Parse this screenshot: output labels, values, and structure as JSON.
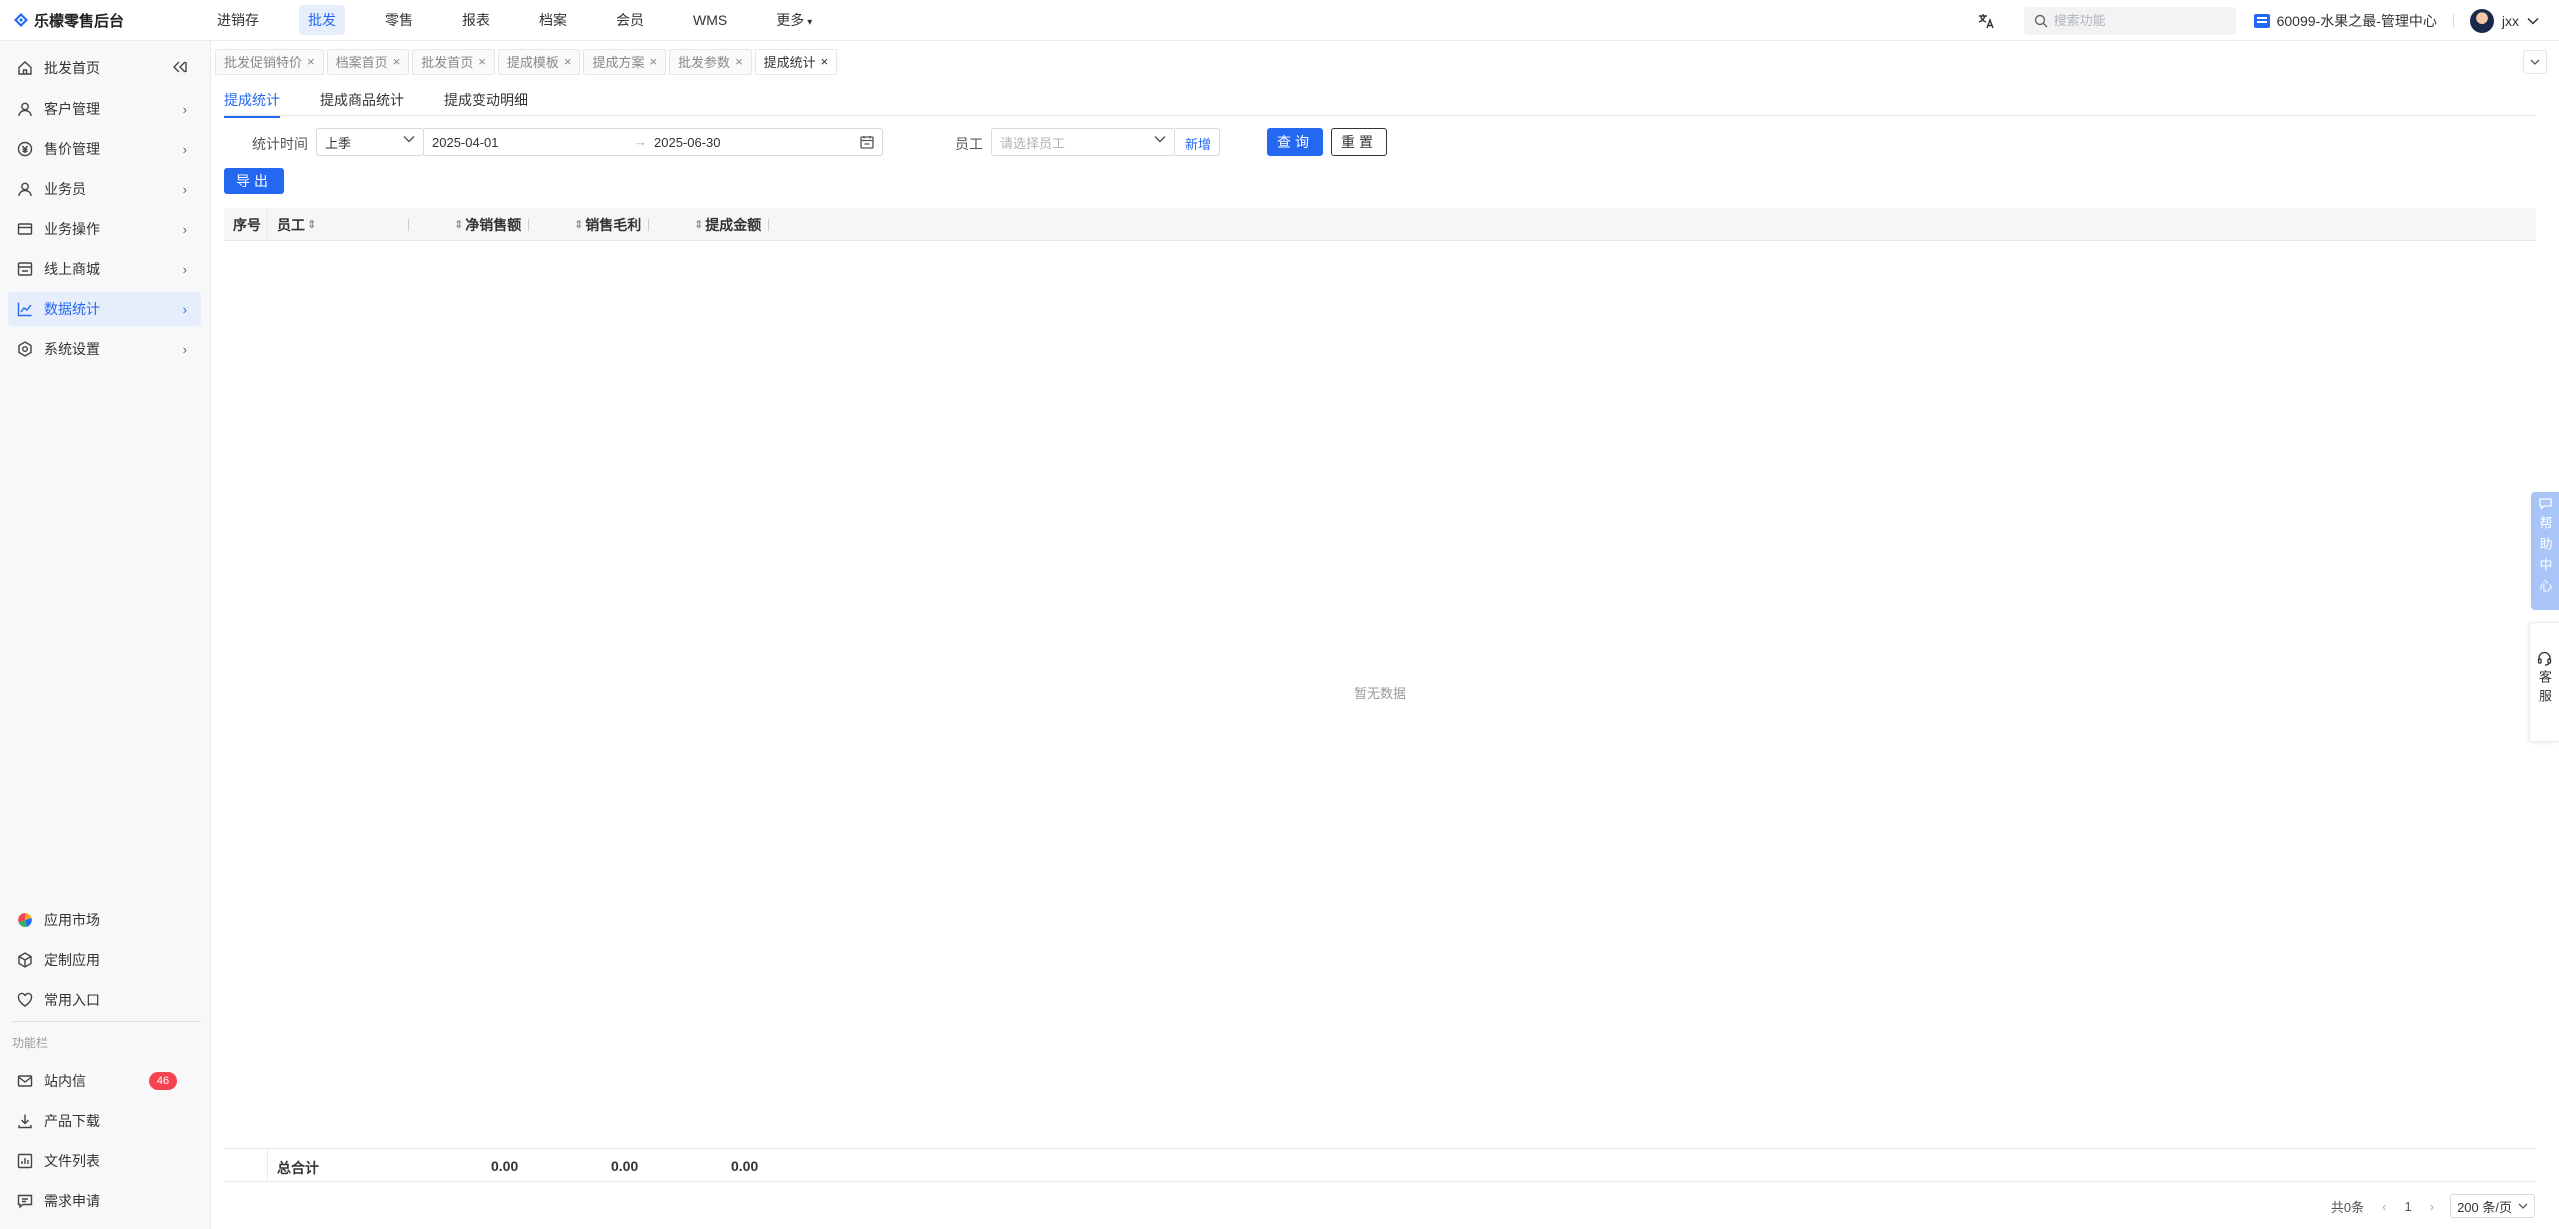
{
  "app": {
    "title": "乐檬零售后台"
  },
  "topnav": [
    {
      "label": "进销存",
      "active": false
    },
    {
      "label": "批发",
      "active": true
    },
    {
      "label": "零售",
      "active": false
    },
    {
      "label": "报表",
      "active": false
    },
    {
      "label": "档案",
      "active": false
    },
    {
      "label": "会员",
      "active": false
    },
    {
      "label": "WMS",
      "active": false
    },
    {
      "label": "更多",
      "active": false
    }
  ],
  "header": {
    "search_placeholder": "搜索功能",
    "store": "60099-水果之最-管理中心",
    "user": "jxx"
  },
  "sidebar": {
    "items": [
      {
        "label": "批发首页",
        "icon": "home-icon"
      },
      {
        "label": "客户管理",
        "icon": "user-icon"
      },
      {
        "label": "售价管理",
        "icon": "price-icon"
      },
      {
        "label": "业务员",
        "icon": "user-icon"
      },
      {
        "label": "业务操作",
        "icon": "card-icon"
      },
      {
        "label": "线上商城",
        "icon": "store-icon"
      },
      {
        "label": "数据统计",
        "icon": "chart-icon",
        "active": true
      },
      {
        "label": "系统设置",
        "icon": "gear-icon"
      }
    ],
    "bottom_items": [
      {
        "label": "应用市场"
      },
      {
        "label": "定制应用"
      },
      {
        "label": "常用入口"
      }
    ],
    "section_label": "功能栏",
    "function_items": [
      {
        "label": "站内信",
        "badge": "46"
      },
      {
        "label": "产品下载"
      },
      {
        "label": "文件列表"
      },
      {
        "label": "需求申请"
      }
    ]
  },
  "page_tabs": [
    {
      "label": "批发促销特价",
      "active": false
    },
    {
      "label": "档案首页",
      "active": false
    },
    {
      "label": "批发首页",
      "active": false
    },
    {
      "label": "提成模板",
      "active": false
    },
    {
      "label": "提成方案",
      "active": false
    },
    {
      "label": "批发参数",
      "active": false
    },
    {
      "label": "提成统计",
      "active": true
    }
  ],
  "subtabs": [
    {
      "label": "提成统计",
      "active": true
    },
    {
      "label": "提成商品统计",
      "active": false
    },
    {
      "label": "提成变动明细",
      "active": false
    }
  ],
  "filters": {
    "time_label": "统计时间",
    "period": "上季",
    "start_date": "2025-04-01",
    "end_date": "2025-06-30",
    "employee_label": "员工",
    "employee_placeholder": "请选择员工",
    "add_label": "新增",
    "query_label": "查询",
    "reset_label": "重置"
  },
  "export_label": "导出",
  "table": {
    "columns": [
      "序号",
      "员工",
      "净销售额",
      "销售毛利",
      "提成金额"
    ],
    "empty_text": "暂无数据",
    "footer": {
      "label": "总合计",
      "net_sales": "0.00",
      "gross_profit": "0.00",
      "commission": "0.00"
    }
  },
  "pagination": {
    "total": "共0条",
    "current": "1",
    "page_size": "200 条/页"
  },
  "float": {
    "help": "帮助中心",
    "service": "客服"
  },
  "colors": {
    "primary": "#2468f2",
    "badge": "#f5434f",
    "sidebar_bg": "#f7f8fa"
  }
}
